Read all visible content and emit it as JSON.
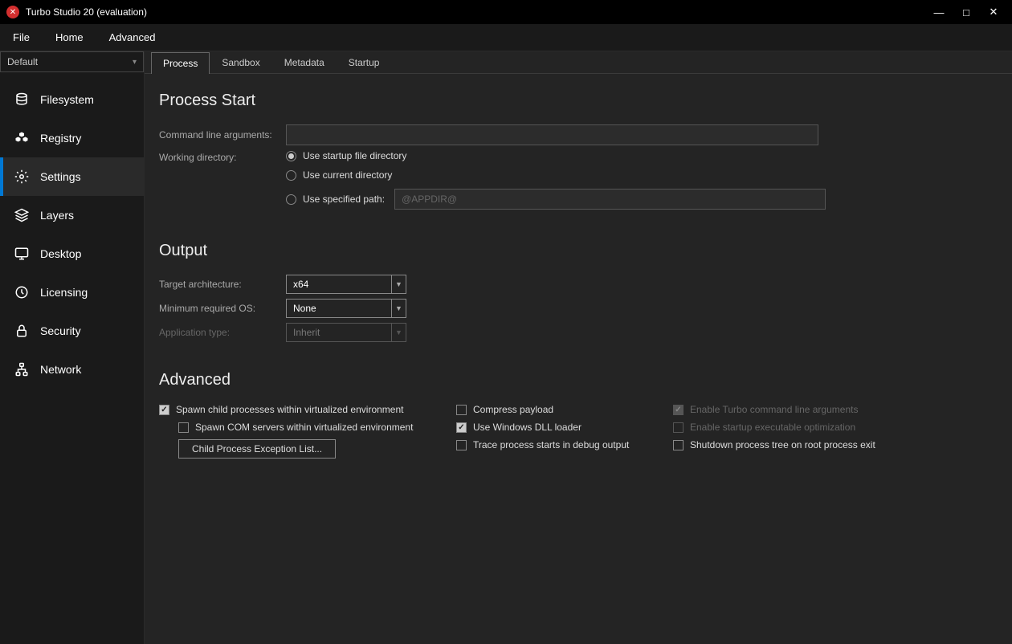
{
  "window": {
    "title": "Turbo Studio 20 (evaluation)"
  },
  "menubar": {
    "file": "File",
    "home": "Home",
    "advanced": "Advanced"
  },
  "sidebar": {
    "project_selector": "Default",
    "items": [
      {
        "label": "Filesystem"
      },
      {
        "label": "Registry"
      },
      {
        "label": "Settings"
      },
      {
        "label": "Layers"
      },
      {
        "label": "Desktop"
      },
      {
        "label": "Licensing"
      },
      {
        "label": "Security"
      },
      {
        "label": "Network"
      }
    ]
  },
  "tabs": {
    "process": "Process",
    "sandbox": "Sandbox",
    "metadata": "Metadata",
    "startup": "Startup"
  },
  "process_start": {
    "heading": "Process Start",
    "cmd_label": "Command line arguments:",
    "cmd_value": "",
    "workdir_label": "Working directory:",
    "radio_startup": "Use startup file directory",
    "radio_current": "Use current directory",
    "radio_specified": "Use specified path:",
    "specified_placeholder": "@APPDIR@"
  },
  "output": {
    "heading": "Output",
    "arch_label": "Target architecture:",
    "arch_value": "x64",
    "os_label": "Minimum required OS:",
    "os_value": "None",
    "apptype_label": "Application type:",
    "apptype_value": "Inherit"
  },
  "advanced": {
    "heading": "Advanced",
    "spawn_child": "Spawn child processes within virtualized environment",
    "spawn_com": "Spawn COM servers within virtualized environment",
    "child_exception_btn": "Child Process Exception List...",
    "compress": "Compress payload",
    "dll_loader": "Use Windows DLL loader",
    "trace": "Trace process starts in debug output",
    "enable_cmdline": "Enable Turbo command line arguments",
    "enable_opt": "Enable startup executable optimization",
    "shutdown": "Shutdown process tree on root process exit"
  }
}
